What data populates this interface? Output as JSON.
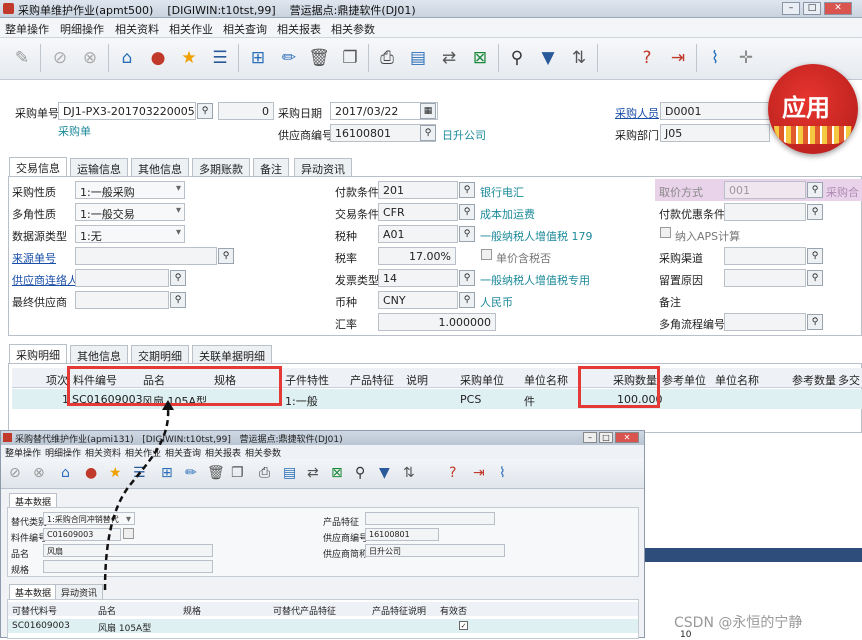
{
  "window": {
    "title": "采购单维护作业(apmt500)",
    "db": "[DIGIWIN:t10tst,99]",
    "site": "营运据点:鼎捷软件(DJ01)"
  },
  "menu": [
    "整单操作",
    "明细操作",
    "相关资料",
    "相关作业",
    "相关查询",
    "相关报表",
    "相关参数"
  ],
  "header": {
    "order_no_label": "采购单号",
    "order_no": "DJ1-PX3-201703220005",
    "order_type": "采购单",
    "seq": "0",
    "date_label": "采购日期",
    "date": "2017/03/22",
    "supplier_label": "供应商编号",
    "supplier_id": "16100801",
    "supplier_name": "日升公司",
    "buyer_label": "采购人员",
    "buyer": "D0001",
    "dept_label": "采购部门",
    "dept": "J05"
  },
  "badge": "应用",
  "tabs": [
    "交易信息",
    "运输信息",
    "其他信息",
    "多期账款",
    "备注",
    "异动资讯"
  ],
  "trade": {
    "c1": [
      {
        "l": "采购性质",
        "v": "1:一般采购"
      },
      {
        "l": "多角性质",
        "v": "1:一般交易"
      },
      {
        "l": "数据源类型",
        "v": "1:无"
      },
      {
        "l": "来源单号",
        "v": ""
      },
      {
        "l": "供应商连络人",
        "v": ""
      },
      {
        "l": "最终供应商",
        "v": ""
      }
    ],
    "c2": [
      {
        "l": "付款条件",
        "v": "201",
        "d": "银行电汇"
      },
      {
        "l": "交易条件",
        "v": "CFR",
        "d": "成本加运费"
      },
      {
        "l": "税种",
        "v": "A01",
        "d": "一般纳税人增值税 179"
      },
      {
        "l": "税率",
        "v": "17.00%",
        "d": "单价含税否"
      },
      {
        "l": "发票类型",
        "v": "14",
        "d": "一般纳税人增值税专用"
      },
      {
        "l": "币种",
        "v": "CNY",
        "d": "人民币"
      },
      {
        "l": "汇率",
        "v": "1.000000",
        "d": ""
      }
    ],
    "c3": [
      "取价方式",
      "付款优惠条件",
      "纳入APS计算",
      "采购渠道",
      "留置原因",
      "备注",
      "多角流程编号"
    ],
    "price_code": "001",
    "price_desc": "采购合"
  },
  "detail_tabs": [
    "采购明细",
    "其他信息",
    "交期明细",
    "关联单据明细"
  ],
  "grid": {
    "headers": [
      "项次",
      "料件编号",
      "品名",
      "规格",
      "子件特性",
      "产品特征",
      "说明",
      "采购单位",
      "单位名称",
      "采购数量",
      "参考单位",
      "单位名称",
      "参考数量",
      "多交"
    ],
    "row": [
      "1",
      "SC01609003",
      "风扇 105A型",
      "",
      "1:一般",
      "",
      "",
      "PCS",
      "件",
      "100.000"
    ]
  },
  "sub": {
    "title": "采购替代维护作业(apmi131)",
    "db": "[DIGIWIN:t10tst,99]",
    "site": "营运据点:鼎捷软件(DJ01)",
    "menu": [
      "整单操作",
      "明细操作",
      "相关资料",
      "相关作业",
      "相关查询",
      "相关报表",
      "相关参数"
    ],
    "tab": "基本数据",
    "f": [
      {
        "l": "替代类别",
        "v": "1:采购合同冲销替代"
      },
      {
        "l": "料件编号",
        "v": "C01609003"
      },
      {
        "l": "品名",
        "v": "风扇"
      },
      {
        "l": "规格",
        "v": ""
      }
    ],
    "r": [
      {
        "l": "产品特征",
        "v": ""
      },
      {
        "l": "供应商编号",
        "v": "16100801"
      },
      {
        "l": "供应商简称",
        "v": "日升公司"
      }
    ],
    "tabs2": [
      "基本数据",
      "异动资讯"
    ],
    "gh": [
      "可替代料号",
      "品名",
      "规格",
      "可替代产品特征",
      "产品特征说明",
      "有效否"
    ],
    "gr": [
      "SC01609003",
      "风扇 105A型"
    ]
  },
  "side": {
    "num": "10"
  },
  "watermark": "CSDN @永恒的宁静"
}
